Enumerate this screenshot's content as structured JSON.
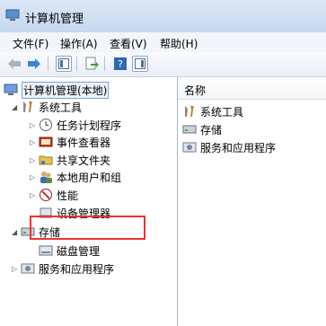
{
  "window": {
    "title": "计算机管理"
  },
  "menu": {
    "file": "文件(F)",
    "action": "操作(A)",
    "view": "查看(V)",
    "help": "帮助(H)"
  },
  "tree": {
    "root": "计算机管理(本地)",
    "system_tools": "系统工具",
    "task_scheduler": "任务计划程序",
    "event_viewer": "事件查看器",
    "shared_folders": "共享文件夹",
    "local_users": "本地用户和组",
    "performance": "性能",
    "device_manager": "设备管理器",
    "storage": "存储",
    "disk_management": "磁盘管理",
    "services_apps": "服务和应用程序"
  },
  "list": {
    "header": "名称",
    "items": [
      "系统工具",
      "存储",
      "服务和应用程序"
    ]
  },
  "colors": {
    "highlight": "#e33333",
    "accent": "#2a6fbd"
  }
}
